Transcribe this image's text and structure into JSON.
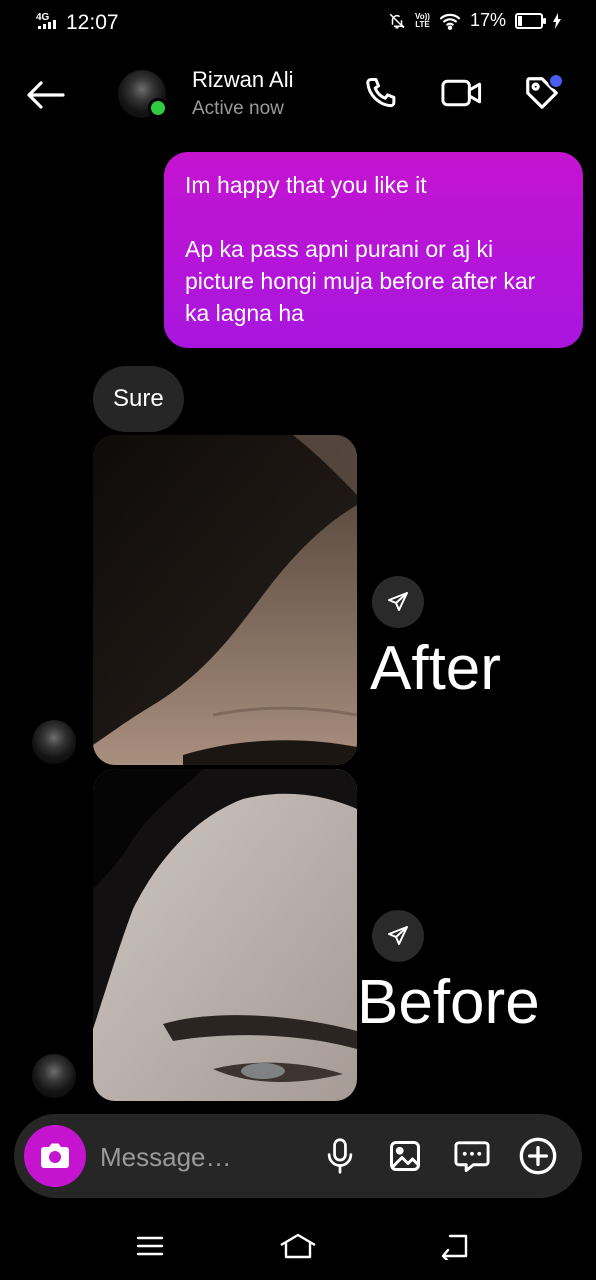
{
  "status_bar": {
    "network": "4G",
    "time": "12:07",
    "lte_label_top": "Vo))",
    "lte_label_bottom": "LTE",
    "battery": "17%",
    "battery_level": 0.17
  },
  "header": {
    "contact_name": "Rizwan Ali",
    "contact_status": "Active now",
    "online": true
  },
  "messages": {
    "outgoing": {
      "line1": "Im happy that you like it",
      "line2": "Ap ka pass apni purani or aj ki picture hongi muja before after kar ka lagna ha"
    },
    "incoming_text": "Sure",
    "photo_captions": [
      "After",
      "Before"
    ]
  },
  "composer": {
    "placeholder": "Message…"
  },
  "colors": {
    "accent": "#c414d0",
    "bubble_out_end": "#a816de",
    "bubble_in": "#262626",
    "online": "#2ecc40",
    "notification_dot": "#4b5cf0"
  }
}
